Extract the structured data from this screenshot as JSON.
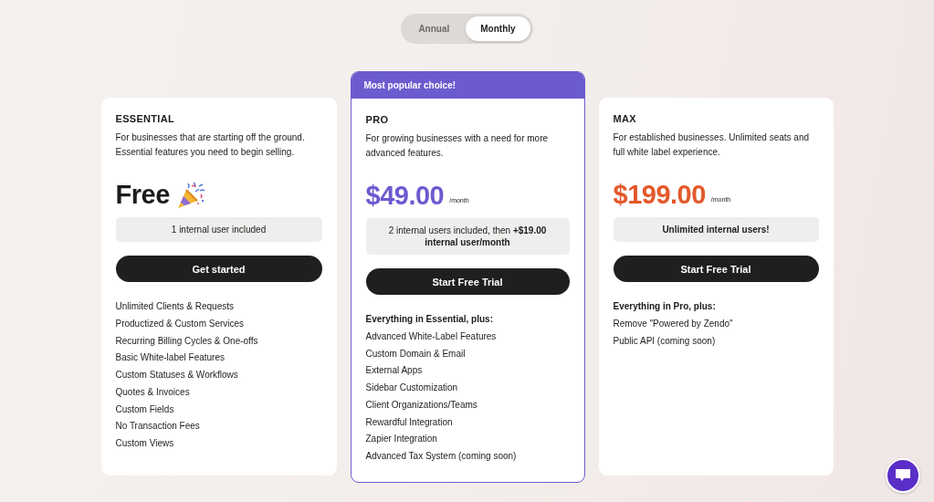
{
  "billing_toggle": [
    {
      "label": "Annual",
      "selected": false
    },
    {
      "label": "Monthly",
      "selected": true
    }
  ],
  "plans": [
    {
      "name": "ESSENTIAL",
      "kind": "free",
      "featured": false,
      "description": "For businesses that are starting off the ground. Essential features you need to begin selling.",
      "price": "Free",
      "color": "#1c1c1c",
      "users_note": "1 internal user included",
      "button": "Get started",
      "features": [
        "Unlimited Clients & Requests",
        "Productized & Custom Services",
        "Recurring Billing Cycles & One-offs",
        "Basic White-label Features",
        "Custom Statuses & Workflows",
        "Quotes & Invoices",
        "Custom Fields",
        "No Transaction Fees",
        "Custom Views"
      ]
    },
    {
      "name": "PRO",
      "kind": "paid",
      "featured": true,
      "badge": "Most popular choice!",
      "description": "For growing businesses with a need for more advanced features.",
      "price": "$49.00",
      "period": "/month",
      "color": "#6b5bcf",
      "users_note": "2 internal users included, then **+$19.00 internal user/month**",
      "button": "Start Free Trial",
      "features_heading": "Everything in Essential, plus:",
      "features": [
        "Advanced White-Label Features",
        "Custom Domain & Email",
        "External Apps",
        "Sidebar Customization",
        "Client Organizations/Teams",
        "Rewardful Integration",
        "Zapier Integration",
        "Advanced Tax System (coming soon)"
      ]
    },
    {
      "name": "MAX",
      "kind": "paid",
      "featured": false,
      "description": "For established businesses. Unlimited seats and full white label experience.",
      "price": "$199.00",
      "period": "/month",
      "color": "#e3592b",
      "users_note": "Unlimited internal users!",
      "users_note_bold": true,
      "button": "Start Free Trial",
      "features_heading": "Everything in Pro, plus:",
      "features": [
        "Remove \"Powered by Zendo\"",
        "Public API (coming soon)"
      ]
    }
  ]
}
